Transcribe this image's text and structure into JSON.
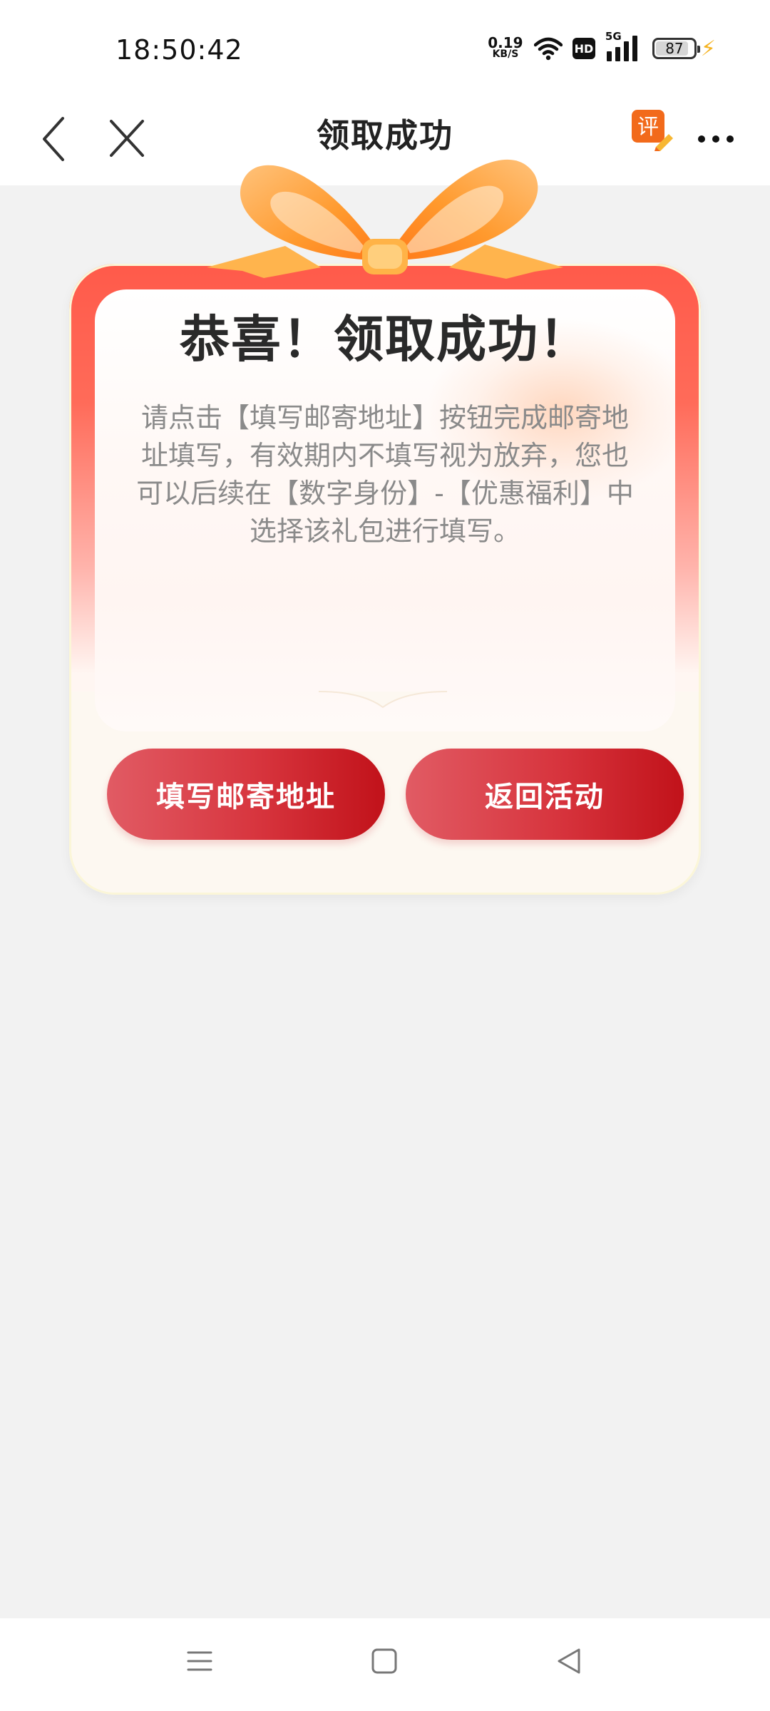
{
  "status_bar": {
    "time": "18:50:42",
    "net_speed_value": "0.19",
    "net_speed_unit": "KB/S",
    "hd_label": "HD",
    "network_label": "5G",
    "battery_level": 87,
    "battery_text": "87"
  },
  "nav": {
    "title": "领取成功",
    "review_icon_label": "评"
  },
  "card": {
    "title": "恭喜！领取成功！",
    "description": "请点击【填写邮寄地址】按钮完成邮寄地址填写，有效期内不填写视为放弃，您也可以后续在【数字身份】-【优惠福利】中选择该礼包进行填写。"
  },
  "buttons": {
    "fill_address": "填写邮寄地址",
    "return_activity": "返回活动"
  },
  "colors": {
    "accent_red": "#d7343d",
    "card_top": "#ff5a4a",
    "bow_orange": "#ff9a2e",
    "page_bg": "#f2f2f2"
  },
  "icons": {
    "back": "chevron-left-icon",
    "close": "close-icon",
    "review": "review-pen-icon",
    "more": "more-icon",
    "sys_menu": "menu-icon",
    "sys_home": "home-square-icon",
    "sys_back": "triangle-back-icon"
  }
}
